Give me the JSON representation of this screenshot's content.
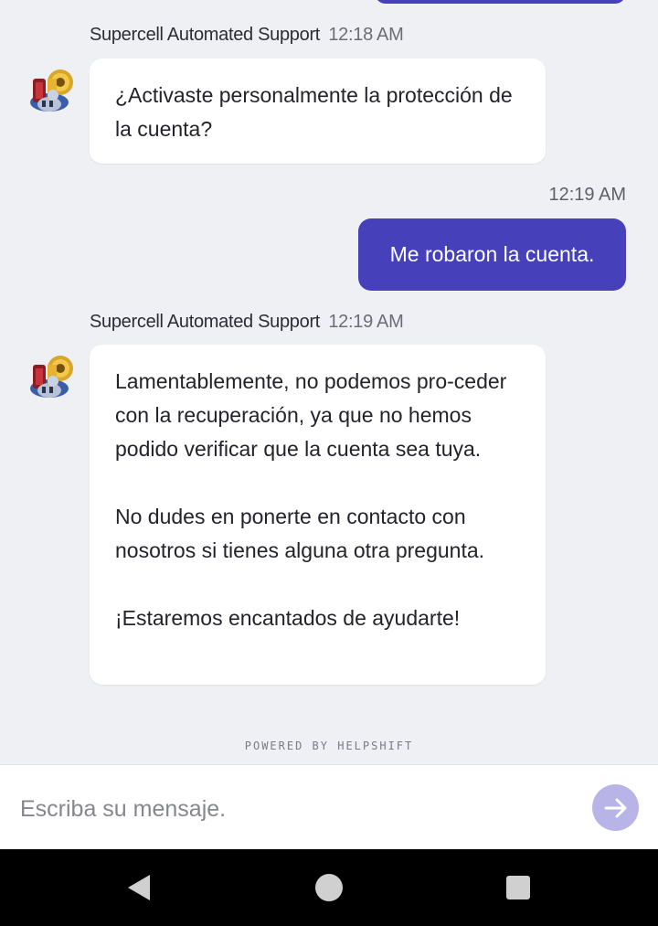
{
  "messages": [
    {
      "sender": "Supercell Automated Support",
      "time": "12:18 AM",
      "paragraphs": [
        "¿Activaste personalmente la protección de la cuenta?"
      ]
    },
    {
      "sender": "user",
      "time": "12:19 AM",
      "text": "Me robaron la cuenta."
    },
    {
      "sender": "Supercell Automated Support",
      "time": "12:19 AM",
      "paragraphs": [
        "Lamentablemente, no podemos pro-ceder con la recuperación, ya que no hemos podido verificar que la cuenta sea tuya.",
        "No dudes en ponerte en contacto con nosotros si tienes alguna otra pregunta.",
        "¡Estaremos encantados de ayudarte!"
      ]
    }
  ],
  "footer": {
    "powered_by": "POWERED BY HELPSHIFT"
  },
  "composer": {
    "placeholder": "Escriba su mensaje."
  },
  "send_icon": "arrow-right-icon",
  "nav": {
    "back_icon": "back-triangle-icon",
    "home_icon": "home-circle-icon",
    "recents_icon": "recents-square-icon"
  },
  "colors": {
    "accent": "#4641bb",
    "send_button": "#b9b4e8",
    "background": "#eff0f4"
  }
}
